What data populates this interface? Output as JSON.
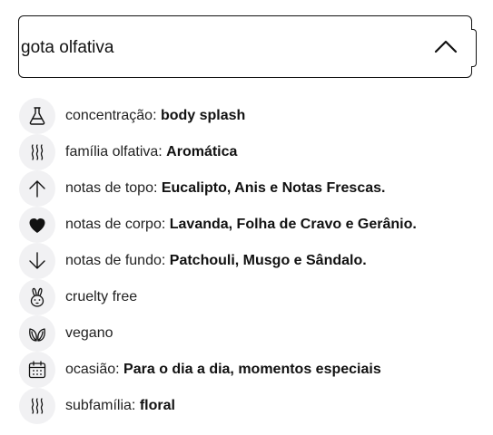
{
  "accordion": {
    "title": "gota olfativa",
    "expanded": true
  },
  "attributes": [
    {
      "icon": "flask-icon",
      "label": "concentração",
      "separator": ": ",
      "value": "body splash"
    },
    {
      "icon": "waves-icon",
      "label": "família olfativa",
      "separator": ": ",
      "value": "Aromática"
    },
    {
      "icon": "arrow-up-icon",
      "label": "notas de topo",
      "separator": ": ",
      "value": "Eucalipto, Anis e Notas Frescas."
    },
    {
      "icon": "heart-icon",
      "label": "notas de corpo",
      "separator": ": ",
      "value": "Lavanda, Folha de Cravo e Gerânio."
    },
    {
      "icon": "arrow-down-icon",
      "label": "notas de fundo",
      "separator": ": ",
      "value": "Patchouli, Musgo e Sândalo."
    },
    {
      "icon": "bunny-icon",
      "label": "cruelty free",
      "separator": "",
      "value": ""
    },
    {
      "icon": "leaves-icon",
      "label": "vegano",
      "separator": "",
      "value": ""
    },
    {
      "icon": "calendar-icon",
      "label": "ocasião",
      "separator": ": ",
      "value": "Para o dia a dia, momentos especiais"
    },
    {
      "icon": "waves-icon",
      "label": "subfamília",
      "separator": ": ",
      "value": "floral"
    }
  ],
  "colors": {
    "text": "#111111",
    "icon_bg": "#f1f1f3",
    "border": "#111111"
  }
}
